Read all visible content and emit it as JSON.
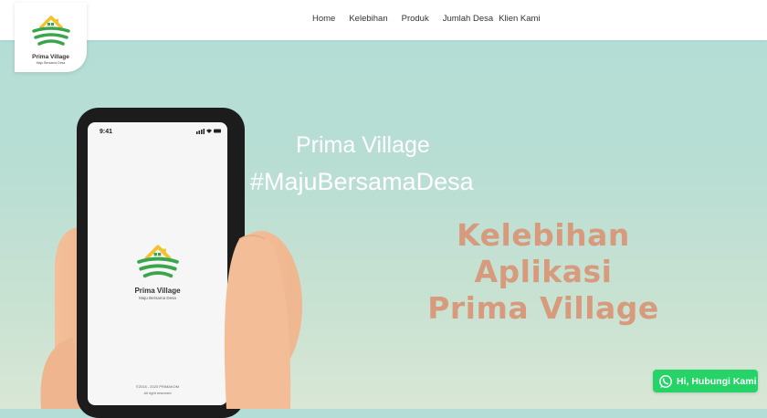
{
  "nav": {
    "items": [
      {
        "label": "Home"
      },
      {
        "label": "Kelebihan"
      },
      {
        "label": "Produk"
      },
      {
        "label": "Jumlah Desa"
      },
      {
        "label": "Klien Kami"
      }
    ]
  },
  "logo": {
    "name": "Prima Village",
    "tagline": "Maju Bersama Desa"
  },
  "hero": {
    "title": "Prima Village",
    "hashtag": "#MajuBersamaDesa",
    "heading_line1": "Kelebihan Aplikasi",
    "heading_line2": "Prima Village"
  },
  "phone": {
    "time": "9:41",
    "app_name": "Prima Village",
    "app_tagline": "Maju Bersama Desa",
    "copyright": "©2018 - 2020 PRIMAKOM",
    "rights": "All right reserved"
  },
  "whatsapp": {
    "label": "Hi, Hubungi Kami"
  },
  "colors": {
    "whatsapp": "#25d366",
    "heading": "#d79a7d",
    "logo_green": "#3aa54a",
    "logo_yellow": "#f2c230"
  }
}
